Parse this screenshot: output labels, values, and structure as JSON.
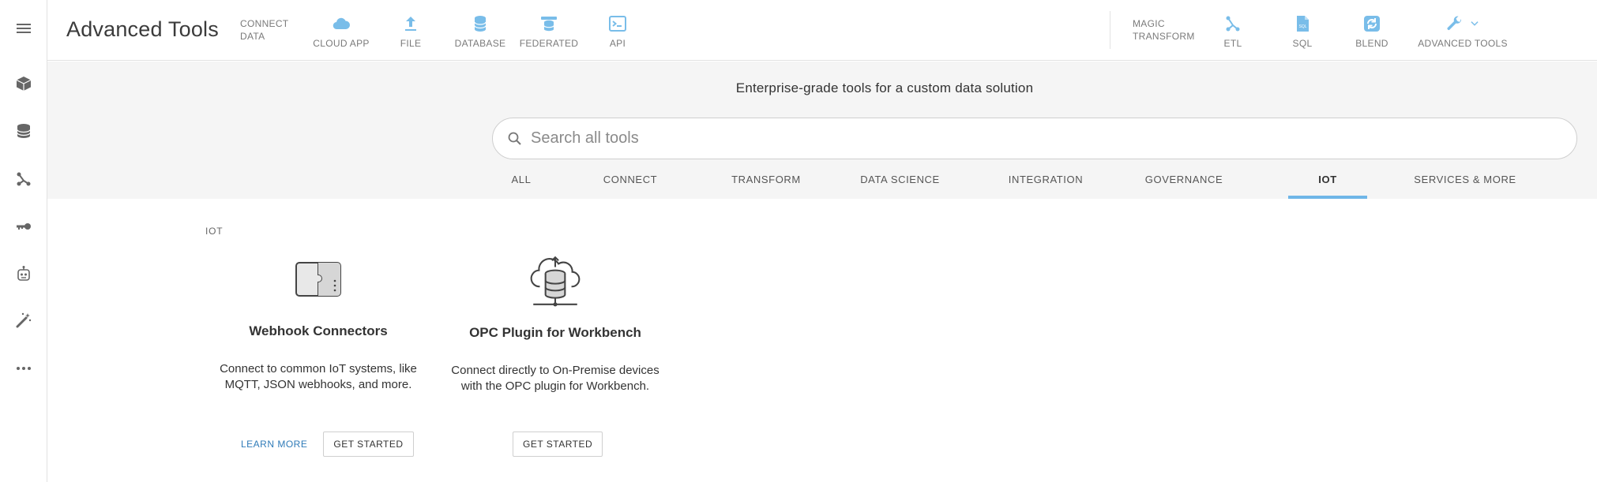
{
  "header": {
    "title": "Advanced Tools",
    "connect_group": {
      "label_line1": "CONNECT",
      "label_line2": "DATA"
    },
    "connect_items": [
      {
        "label": "CLOUD APP",
        "icon": "cloud-icon"
      },
      {
        "label": "FILE",
        "icon": "upload-icon"
      },
      {
        "label": "DATABASE",
        "icon": "database-icon"
      },
      {
        "label": "FEDERATED",
        "icon": "federated-icon"
      },
      {
        "label": "API",
        "icon": "terminal-icon"
      }
    ],
    "transform_group": {
      "label_line1": "MAGIC",
      "label_line2": "TRANSFORM"
    },
    "transform_items": [
      {
        "label": "ETL",
        "icon": "etl-icon"
      },
      {
        "label": "SQL",
        "icon": "sql-file-icon"
      },
      {
        "label": "BLEND",
        "icon": "blend-icon"
      },
      {
        "label": "ADVANCED TOOLS",
        "icon": "wrench-icon"
      }
    ]
  },
  "sidebar": {
    "items": [
      {
        "icon": "menu-icon"
      },
      {
        "icon": "cube-icon"
      },
      {
        "icon": "database-icon"
      },
      {
        "icon": "etl-icon"
      },
      {
        "icon": "key-icon"
      },
      {
        "icon": "robot-icon"
      },
      {
        "icon": "magic-wand-icon"
      },
      {
        "icon": "more-icon"
      }
    ]
  },
  "hero": {
    "title": "Enterprise-grade tools for a custom data solution",
    "search_placeholder": "Search all tools"
  },
  "tabs": [
    {
      "label": "ALL"
    },
    {
      "label": "CONNECT"
    },
    {
      "label": "TRANSFORM"
    },
    {
      "label": "DATA SCIENCE"
    },
    {
      "label": "INTEGRATION"
    },
    {
      "label": "GOVERNANCE"
    },
    {
      "label": "IOT",
      "active": true
    },
    {
      "label": "SERVICES & MORE"
    }
  ],
  "content": {
    "section_label": "IOT",
    "cards": [
      {
        "title": "Webhook Connectors",
        "desc_line1": "Connect to common IoT systems, like",
        "desc_line2": "MQTT, JSON webhooks, and more.",
        "learn_more": "LEARN MORE",
        "get_started": "GET STARTED",
        "icon": "puzzle-icon"
      },
      {
        "title": "OPC Plugin for Workbench",
        "desc_line1": "Connect directly to On-Premise devices",
        "desc_line2": "with the OPC plugin for Workbench.",
        "get_started": "GET STARTED",
        "icon": "cloud-database-icon"
      }
    ]
  },
  "colors": {
    "accent": "#6fb6e8",
    "link": "#2f7bb8",
    "icon_gray": "#666666",
    "icon_blue": "#79bde9"
  }
}
